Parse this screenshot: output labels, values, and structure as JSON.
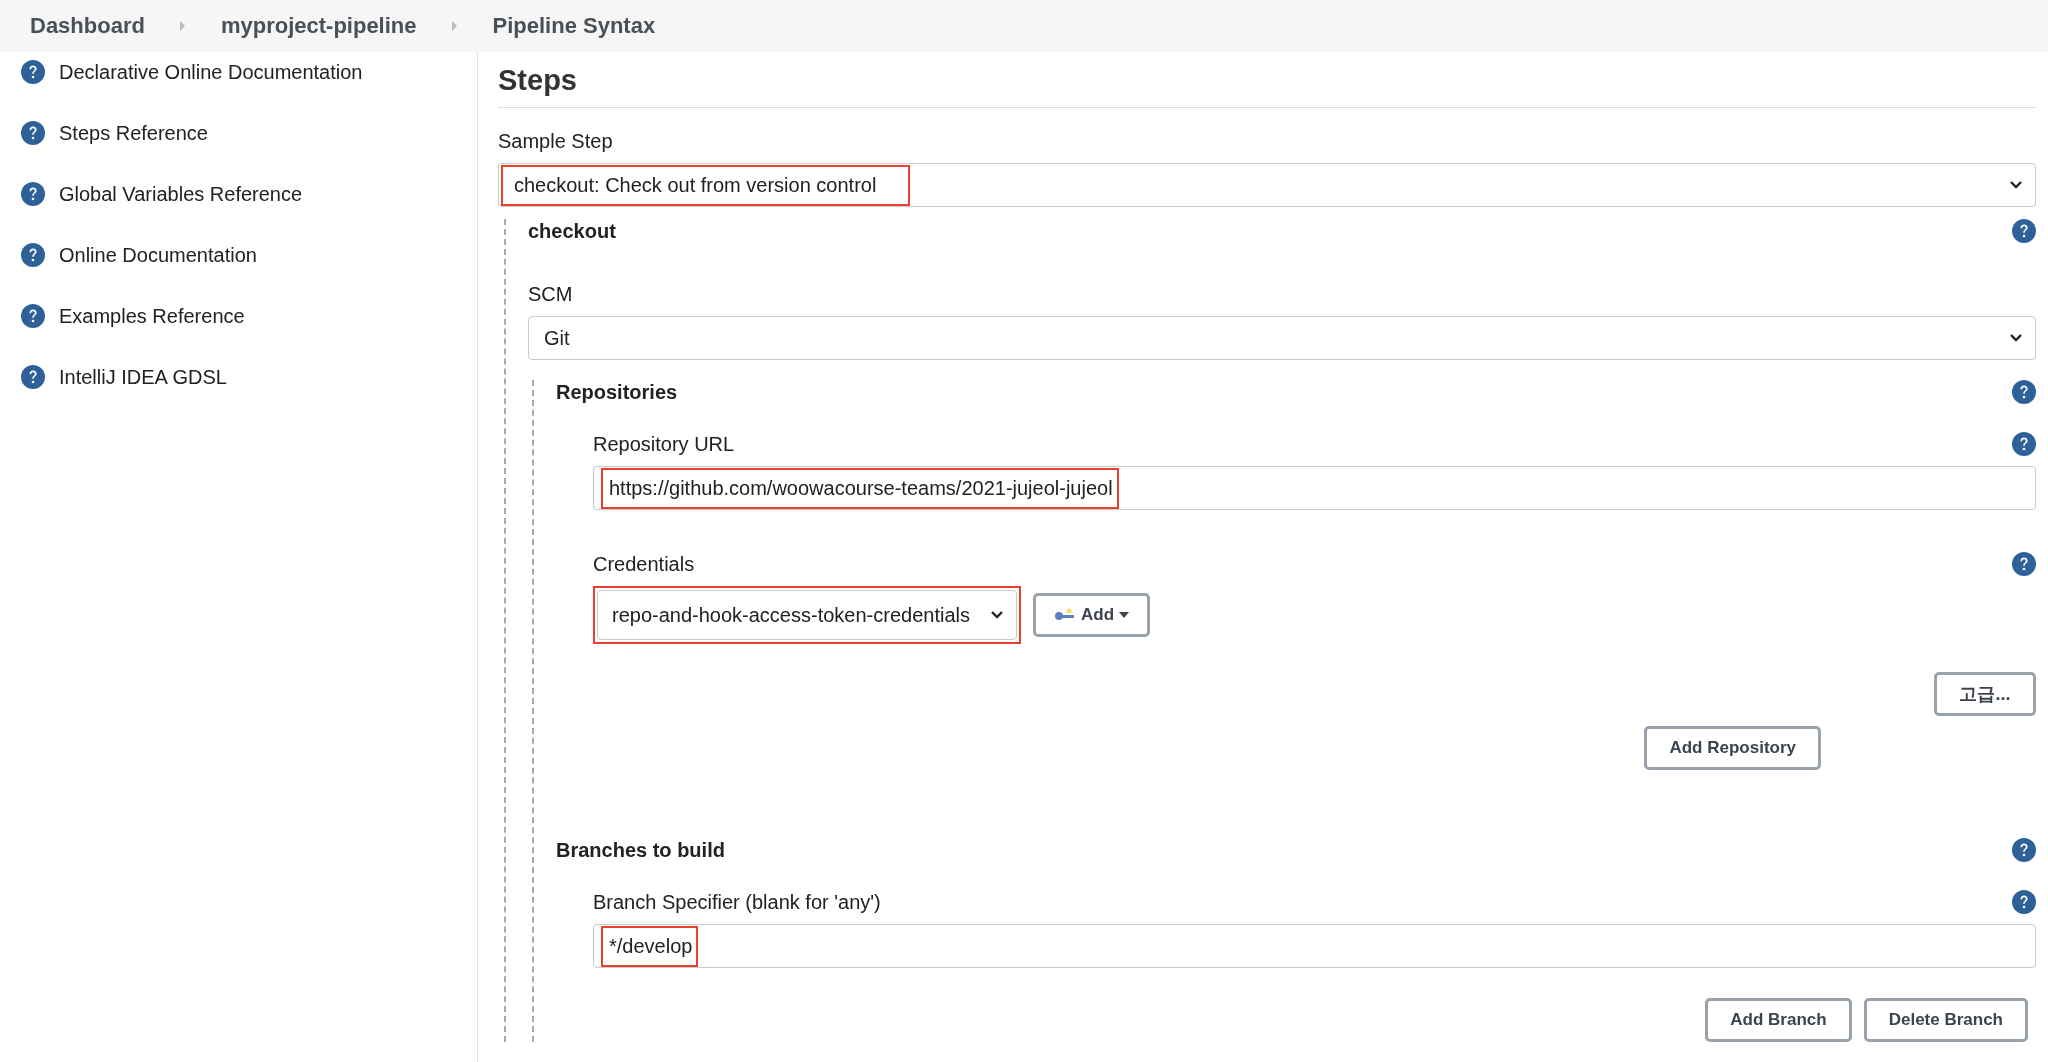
{
  "breadcrumbs": [
    "Dashboard",
    "myproject-pipeline",
    "Pipeline Syntax"
  ],
  "sidebar": {
    "items": [
      {
        "label": "Declarative Online Documentation"
      },
      {
        "label": "Steps Reference"
      },
      {
        "label": "Global Variables Reference"
      },
      {
        "label": "Online Documentation"
      },
      {
        "label": "Examples Reference"
      },
      {
        "label": "IntelliJ IDEA GDSL"
      }
    ]
  },
  "main": {
    "title": "Steps",
    "sample_step": {
      "label": "Sample Step",
      "value": "checkout: Check out from version control",
      "highlighted": true
    },
    "step": {
      "title": "checkout",
      "scm": {
        "label": "SCM",
        "value": "Git"
      },
      "repositories": {
        "label": "Repositories",
        "url": {
          "label": "Repository URL",
          "value": "https://github.com/woowacourse-teams/2021-jujeol-jujeol",
          "highlighted": true
        },
        "credentials": {
          "label": "Credentials",
          "value": "repo-and-hook-access-token-credentials",
          "highlighted": true,
          "add_button": "Add"
        },
        "advanced_button": "고급...",
        "add_button": "Add Repository"
      },
      "branches": {
        "label": "Branches to build",
        "specifier": {
          "label": "Branch Specifier (blank for 'any')",
          "value": "*/develop",
          "highlighted": true
        },
        "add_button": "Add Branch",
        "delete_button": "Delete Branch"
      }
    }
  }
}
